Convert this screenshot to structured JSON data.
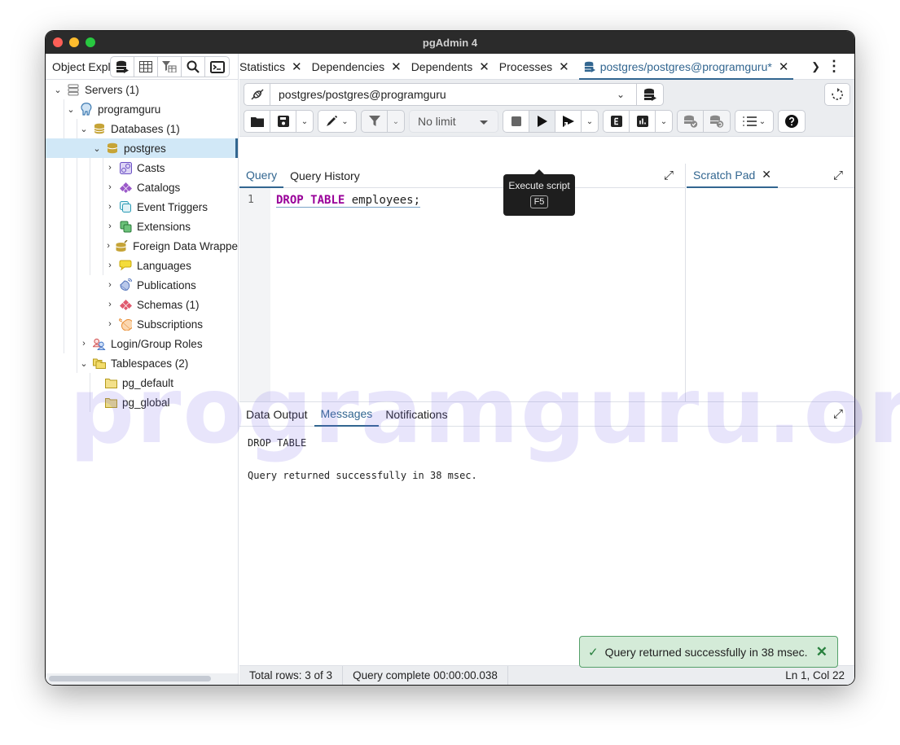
{
  "window": {
    "title": "pgAdmin 4"
  },
  "object_explorer": {
    "title": "Object Explorer",
    "toolbar": [
      "query-tool-icon",
      "view-data-icon",
      "filtered-rows-icon",
      "search-objects-icon",
      "psql-tool-icon"
    ],
    "tree": [
      {
        "label": "Servers (1)",
        "icon": "servers-icon",
        "expanded": true
      },
      {
        "label": "programguru",
        "icon": "elephant-server-icon",
        "expanded": true
      },
      {
        "label": "Databases (1)",
        "icon": "databases-icon",
        "expanded": true
      },
      {
        "label": "postgres",
        "icon": "database-icon",
        "expanded": true,
        "selected": true
      },
      {
        "label": "Casts",
        "icon": "casts-icon"
      },
      {
        "label": "Catalogs",
        "icon": "catalogs-icon"
      },
      {
        "label": "Event Triggers",
        "icon": "event-triggers-icon"
      },
      {
        "label": "Extensions",
        "icon": "extensions-icon"
      },
      {
        "label": "Foreign Data Wrappe",
        "icon": "foreign-data-wrappers-icon"
      },
      {
        "label": "Languages",
        "icon": "languages-icon"
      },
      {
        "label": "Publications",
        "icon": "publications-icon"
      },
      {
        "label": "Schemas (1)",
        "icon": "schemas-icon"
      },
      {
        "label": "Subscriptions",
        "icon": "subscriptions-icon"
      },
      {
        "label": "Login/Group Roles",
        "icon": "roles-icon"
      },
      {
        "label": "Tablespaces (2)",
        "icon": "tablespaces-icon",
        "expanded": true
      },
      {
        "label": "pg_default",
        "icon": "folder-icon"
      },
      {
        "label": "pg_global",
        "icon": "folder-icon"
      }
    ]
  },
  "tabs": [
    {
      "label": "Statistics"
    },
    {
      "label": "Dependencies"
    },
    {
      "label": "Dependents"
    },
    {
      "label": "Processes"
    },
    {
      "label": "postgres/postgres@programguru*",
      "active": true
    }
  ],
  "query_tool": {
    "connection": "postgres/postgres@programguru",
    "limit": "No limit",
    "tooltip": {
      "title": "Execute script",
      "shortcut": "F5"
    },
    "editor_tabs": [
      {
        "label": "Query",
        "active": true
      },
      {
        "label": "Query History"
      }
    ],
    "scratch_pad": "Scratch Pad",
    "line_number": "1",
    "code": {
      "kw1": "DROP",
      "kw2": "TABLE",
      "rest": "employees;"
    },
    "result_tabs": [
      {
        "label": "Data Output"
      },
      {
        "label": "Messages",
        "active": true
      },
      {
        "label": "Notifications"
      }
    ],
    "messages": [
      "DROP TABLE",
      "",
      "Query returned successfully in 38 msec."
    ]
  },
  "status": {
    "total_rows": "Total rows: 3 of 3",
    "query_complete": "Query complete 00:00:00.038",
    "cursor": "Ln 1, Col 22"
  },
  "toast": {
    "message": "Query returned successfully in 38 msec.",
    "type": "success"
  },
  "watermark": "programguru.org",
  "colors": {
    "accent": "#326690",
    "keyword": "#990099",
    "toast_bg": "#d4ebd8",
    "toast_border": "#55a06a"
  }
}
